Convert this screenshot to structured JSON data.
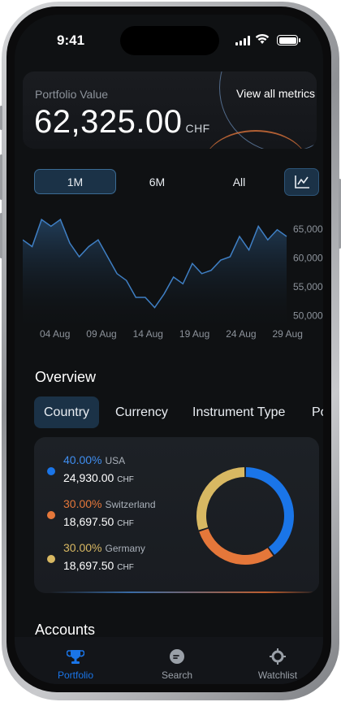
{
  "status_bar": {
    "time": "9:41"
  },
  "portfolio": {
    "label": "Portfolio Value",
    "value": "62,325.00",
    "currency": "CHF",
    "metrics_link": "View all metrics"
  },
  "range": {
    "options": [
      "1M",
      "6M",
      "All"
    ],
    "selected": "1M",
    "chart_button_icon": "line-chart-icon"
  },
  "chart_data": {
    "type": "area",
    "x_labels": [
      "04 Aug",
      "09 Aug",
      "14 Aug",
      "19 Aug",
      "24 Aug",
      "29 Aug"
    ],
    "y_labels": [
      "65,000",
      "60,000",
      "55,000",
      "50,000"
    ],
    "ylim": [
      50000,
      65000
    ],
    "values": [
      61500,
      60500,
      64500,
      63500,
      64500,
      61000,
      59000,
      60500,
      61500,
      59000,
      56500,
      55500,
      53000,
      53000,
      51500,
      53500,
      56000,
      55000,
      58000,
      56500,
      57000,
      58500,
      59000,
      62000,
      60000,
      63500,
      61500,
      63000,
      62000
    ],
    "color": "#3f7fc4"
  },
  "overview": {
    "title": "Overview",
    "tabs": [
      "Country",
      "Currency",
      "Instrument Type",
      "Pos"
    ],
    "selected_tab": "Country"
  },
  "allocation": {
    "items": [
      {
        "percent": "40.00%",
        "name": "USA",
        "amount": "24,930.00",
        "currency": "CHF",
        "color": "#1a75e8",
        "share": 40
      },
      {
        "percent": "30.00%",
        "name": "Switzerland",
        "amount": "18,697.50",
        "currency": "CHF",
        "color": "#e5773a",
        "share": 30
      },
      {
        "percent": "30.00%",
        "name": "Germany",
        "amount": "18,697.50",
        "currency": "CHF",
        "color": "#d8b862",
        "share": 30
      }
    ]
  },
  "accounts": {
    "title": "Accounts"
  },
  "nav": {
    "items": [
      {
        "label": "Portfolio",
        "icon": "trophy-icon",
        "active": true
      },
      {
        "label": "Search",
        "icon": "search-bubble-icon",
        "active": false
      },
      {
        "label": "Watchlist",
        "icon": "crosshair-icon",
        "active": false
      }
    ],
    "accent": "#1a75e8"
  }
}
